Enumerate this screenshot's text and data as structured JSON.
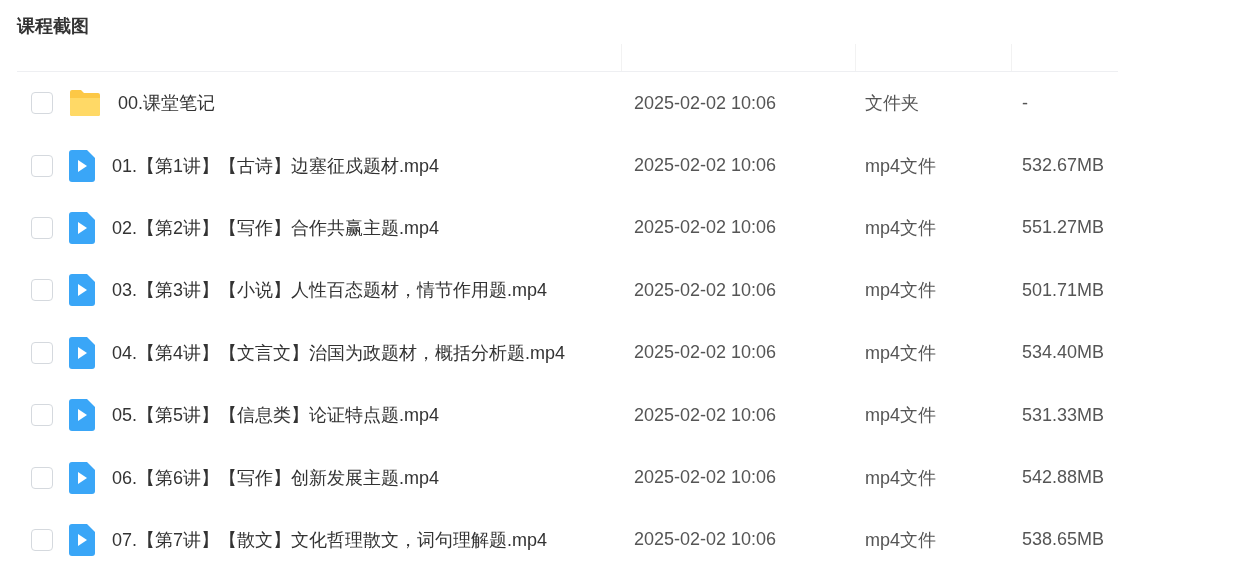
{
  "title": "课程截图",
  "rows": [
    {
      "kind": "folder",
      "checked": false,
      "name": "00.课堂笔记",
      "date": "2025-02-02 10:06",
      "type": "文件夹",
      "size": "-"
    },
    {
      "kind": "video",
      "checked": false,
      "name": "01.【第1讲】【古诗】边塞征戍题材.mp4",
      "date": "2025-02-02 10:06",
      "type": "mp4文件",
      "size": "532.67MB"
    },
    {
      "kind": "video",
      "checked": false,
      "name": "02.【第2讲】【写作】合作共赢主题.mp4",
      "date": "2025-02-02 10:06",
      "type": "mp4文件",
      "size": "551.27MB"
    },
    {
      "kind": "video",
      "checked": false,
      "name": "03.【第3讲】【小说】人性百态题材，情节作用题.mp4",
      "date": "2025-02-02 10:06",
      "type": "mp4文件",
      "size": "501.71MB"
    },
    {
      "kind": "video",
      "checked": false,
      "name": "04.【第4讲】【文言文】治国为政题材，概括分析题.mp4",
      "date": "2025-02-02 10:06",
      "type": "mp4文件",
      "size": "534.40MB"
    },
    {
      "kind": "video",
      "checked": false,
      "name": "05.【第5讲】【信息类】论证特点题.mp4",
      "date": "2025-02-02 10:06",
      "type": "mp4文件",
      "size": "531.33MB"
    },
    {
      "kind": "video",
      "checked": false,
      "name": "06.【第6讲】【写作】创新发展主题.mp4",
      "date": "2025-02-02 10:06",
      "type": "mp4文件",
      "size": "542.88MB"
    },
    {
      "kind": "video",
      "checked": false,
      "name": "07.【第7讲】【散文】文化哲理散文，词句理解题.mp4",
      "date": "2025-02-02 10:06",
      "type": "mp4文件",
      "size": "538.65MB"
    }
  ]
}
